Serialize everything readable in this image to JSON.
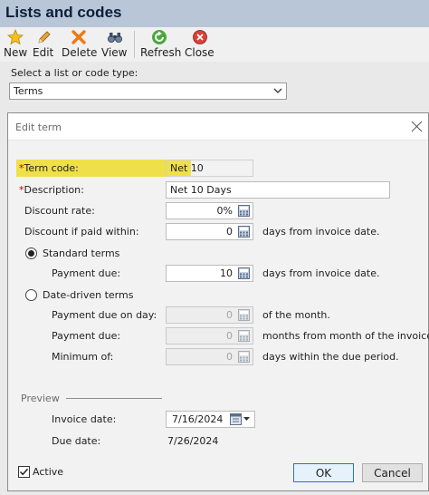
{
  "window": {
    "title": "Lists and codes"
  },
  "toolbar": {
    "new_label": "New",
    "edit_label": "Edit",
    "delete_label": "Delete",
    "view_label": "View",
    "refresh_label": "Refresh",
    "close_label": "Close"
  },
  "list_picker": {
    "label": "Select a list or code type:",
    "value": "Terms"
  },
  "dialog": {
    "title": "Edit term",
    "term_code": {
      "label": "Term code:",
      "value": "Net 10"
    },
    "description": {
      "label": "Description:",
      "value": "Net 10 Days"
    },
    "required_marker": "*",
    "discount_rate": {
      "label": "Discount rate:",
      "value": "0%"
    },
    "discount_within": {
      "label": "Discount if paid within:",
      "value": "0",
      "suffix": "days from invoice date."
    },
    "standard_terms": {
      "label": "Standard terms",
      "selected": true,
      "payment_due": {
        "label": "Payment due:",
        "value": "10",
        "suffix": "days from invoice date."
      }
    },
    "date_driven_terms": {
      "label": "Date-driven terms",
      "selected": false,
      "payment_due_on_day": {
        "label": "Payment due on day:",
        "value": "0",
        "suffix": "of the month."
      },
      "payment_due": {
        "label": "Payment due:",
        "value": "0",
        "suffix": "months from month of the invoice."
      },
      "minimum_of": {
        "label": "Minimum of:",
        "value": "0",
        "suffix": "days within the due period."
      }
    },
    "preview": {
      "heading": "Preview",
      "invoice_date": {
        "label": "Invoice date:",
        "value": "7/16/2024"
      },
      "due_date": {
        "label": "Due date:",
        "value": "7/26/2024"
      }
    },
    "active": {
      "label": "Active",
      "checked": true
    },
    "ok_label": "OK",
    "cancel_label": "Cancel"
  },
  "colors": {
    "title_bar": "#b8c6d8",
    "required": "#c00000",
    "highlight": "#efe04a",
    "default_button_border": "#2a6fd6"
  }
}
